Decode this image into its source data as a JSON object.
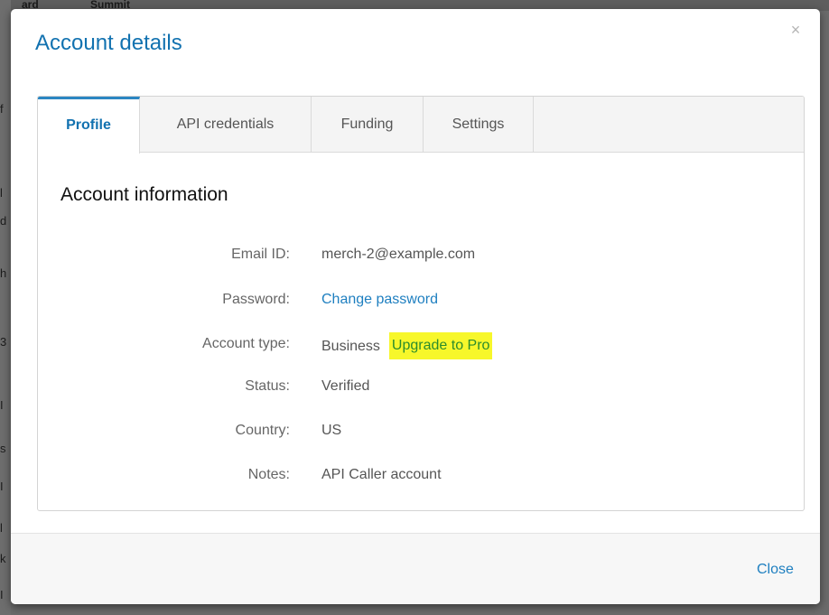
{
  "background": {
    "top_fragment_1": "ard",
    "top_fragment_2": "Summit",
    "side_marks": [
      "f",
      "l",
      "d",
      "h",
      "3",
      "I",
      "s",
      "I",
      "l",
      "k",
      "I"
    ]
  },
  "modal": {
    "title": "Account details",
    "close_glyph": "×",
    "tabs": [
      {
        "label": "Profile",
        "active": true
      },
      {
        "label": "API credentials",
        "active": false
      },
      {
        "label": "Funding",
        "active": false
      },
      {
        "label": "Settings",
        "active": false
      }
    ],
    "section_title": "Account information",
    "fields": {
      "email": {
        "label": "Email ID:",
        "value": "merch-2@example.com"
      },
      "password": {
        "label": "Password:",
        "link": "Change password"
      },
      "account_type": {
        "label": "Account type:",
        "value": "Business",
        "upgrade": "Upgrade to Pro"
      },
      "status": {
        "label": "Status:",
        "value": "Verified"
      },
      "country": {
        "label": "Country:",
        "value": "US"
      },
      "notes": {
        "label": "Notes:",
        "value": "API Caller account"
      }
    },
    "footer": {
      "close_label": "Close"
    }
  },
  "colors": {
    "accent": "#1272b0",
    "link": "#1e7fc0",
    "highlight": "#f7f72b",
    "upgrade_text": "#2c8d2c"
  }
}
